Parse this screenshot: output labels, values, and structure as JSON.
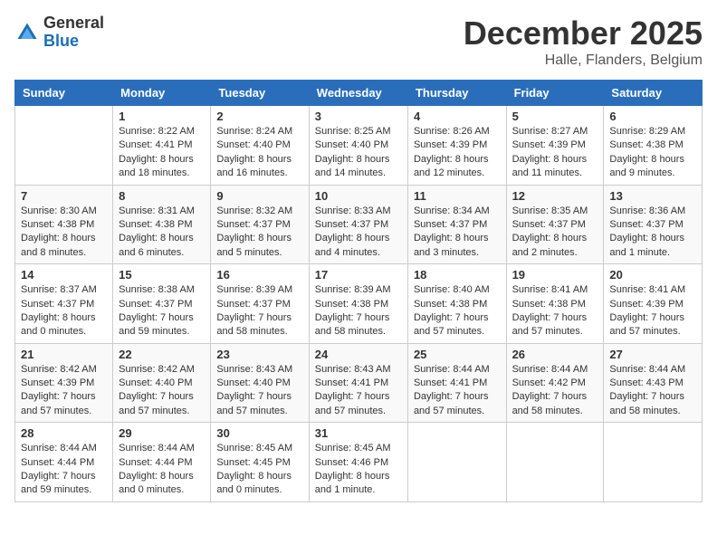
{
  "header": {
    "logo_general": "General",
    "logo_blue": "Blue",
    "month_title": "December 2025",
    "location": "Halle, Flanders, Belgium"
  },
  "weekdays": [
    "Sunday",
    "Monday",
    "Tuesday",
    "Wednesday",
    "Thursday",
    "Friday",
    "Saturday"
  ],
  "weeks": [
    [
      {
        "day": "",
        "info": ""
      },
      {
        "day": "1",
        "info": "Sunrise: 8:22 AM\nSunset: 4:41 PM\nDaylight: 8 hours\nand 18 minutes."
      },
      {
        "day": "2",
        "info": "Sunrise: 8:24 AM\nSunset: 4:40 PM\nDaylight: 8 hours\nand 16 minutes."
      },
      {
        "day": "3",
        "info": "Sunrise: 8:25 AM\nSunset: 4:40 PM\nDaylight: 8 hours\nand 14 minutes."
      },
      {
        "day": "4",
        "info": "Sunrise: 8:26 AM\nSunset: 4:39 PM\nDaylight: 8 hours\nand 12 minutes."
      },
      {
        "day": "5",
        "info": "Sunrise: 8:27 AM\nSunset: 4:39 PM\nDaylight: 8 hours\nand 11 minutes."
      },
      {
        "day": "6",
        "info": "Sunrise: 8:29 AM\nSunset: 4:38 PM\nDaylight: 8 hours\nand 9 minutes."
      }
    ],
    [
      {
        "day": "7",
        "info": "Sunrise: 8:30 AM\nSunset: 4:38 PM\nDaylight: 8 hours\nand 8 minutes."
      },
      {
        "day": "8",
        "info": "Sunrise: 8:31 AM\nSunset: 4:38 PM\nDaylight: 8 hours\nand 6 minutes."
      },
      {
        "day": "9",
        "info": "Sunrise: 8:32 AM\nSunset: 4:37 PM\nDaylight: 8 hours\nand 5 minutes."
      },
      {
        "day": "10",
        "info": "Sunrise: 8:33 AM\nSunset: 4:37 PM\nDaylight: 8 hours\nand 4 minutes."
      },
      {
        "day": "11",
        "info": "Sunrise: 8:34 AM\nSunset: 4:37 PM\nDaylight: 8 hours\nand 3 minutes."
      },
      {
        "day": "12",
        "info": "Sunrise: 8:35 AM\nSunset: 4:37 PM\nDaylight: 8 hours\nand 2 minutes."
      },
      {
        "day": "13",
        "info": "Sunrise: 8:36 AM\nSunset: 4:37 PM\nDaylight: 8 hours\nand 1 minute."
      }
    ],
    [
      {
        "day": "14",
        "info": "Sunrise: 8:37 AM\nSunset: 4:37 PM\nDaylight: 8 hours\nand 0 minutes."
      },
      {
        "day": "15",
        "info": "Sunrise: 8:38 AM\nSunset: 4:37 PM\nDaylight: 7 hours\nand 59 minutes."
      },
      {
        "day": "16",
        "info": "Sunrise: 8:39 AM\nSunset: 4:37 PM\nDaylight: 7 hours\nand 58 minutes."
      },
      {
        "day": "17",
        "info": "Sunrise: 8:39 AM\nSunset: 4:38 PM\nDaylight: 7 hours\nand 58 minutes."
      },
      {
        "day": "18",
        "info": "Sunrise: 8:40 AM\nSunset: 4:38 PM\nDaylight: 7 hours\nand 57 minutes."
      },
      {
        "day": "19",
        "info": "Sunrise: 8:41 AM\nSunset: 4:38 PM\nDaylight: 7 hours\nand 57 minutes."
      },
      {
        "day": "20",
        "info": "Sunrise: 8:41 AM\nSunset: 4:39 PM\nDaylight: 7 hours\nand 57 minutes."
      }
    ],
    [
      {
        "day": "21",
        "info": "Sunrise: 8:42 AM\nSunset: 4:39 PM\nDaylight: 7 hours\nand 57 minutes."
      },
      {
        "day": "22",
        "info": "Sunrise: 8:42 AM\nSunset: 4:40 PM\nDaylight: 7 hours\nand 57 minutes."
      },
      {
        "day": "23",
        "info": "Sunrise: 8:43 AM\nSunset: 4:40 PM\nDaylight: 7 hours\nand 57 minutes."
      },
      {
        "day": "24",
        "info": "Sunrise: 8:43 AM\nSunset: 4:41 PM\nDaylight: 7 hours\nand 57 minutes."
      },
      {
        "day": "25",
        "info": "Sunrise: 8:44 AM\nSunset: 4:41 PM\nDaylight: 7 hours\nand 57 minutes."
      },
      {
        "day": "26",
        "info": "Sunrise: 8:44 AM\nSunset: 4:42 PM\nDaylight: 7 hours\nand 58 minutes."
      },
      {
        "day": "27",
        "info": "Sunrise: 8:44 AM\nSunset: 4:43 PM\nDaylight: 7 hours\nand 58 minutes."
      }
    ],
    [
      {
        "day": "28",
        "info": "Sunrise: 8:44 AM\nSunset: 4:44 PM\nDaylight: 7 hours\nand 59 minutes."
      },
      {
        "day": "29",
        "info": "Sunrise: 8:44 AM\nSunset: 4:44 PM\nDaylight: 8 hours\nand 0 minutes."
      },
      {
        "day": "30",
        "info": "Sunrise: 8:45 AM\nSunset: 4:45 PM\nDaylight: 8 hours\nand 0 minutes."
      },
      {
        "day": "31",
        "info": "Sunrise: 8:45 AM\nSunset: 4:46 PM\nDaylight: 8 hours\nand 1 minute."
      },
      {
        "day": "",
        "info": ""
      },
      {
        "day": "",
        "info": ""
      },
      {
        "day": "",
        "info": ""
      }
    ]
  ]
}
